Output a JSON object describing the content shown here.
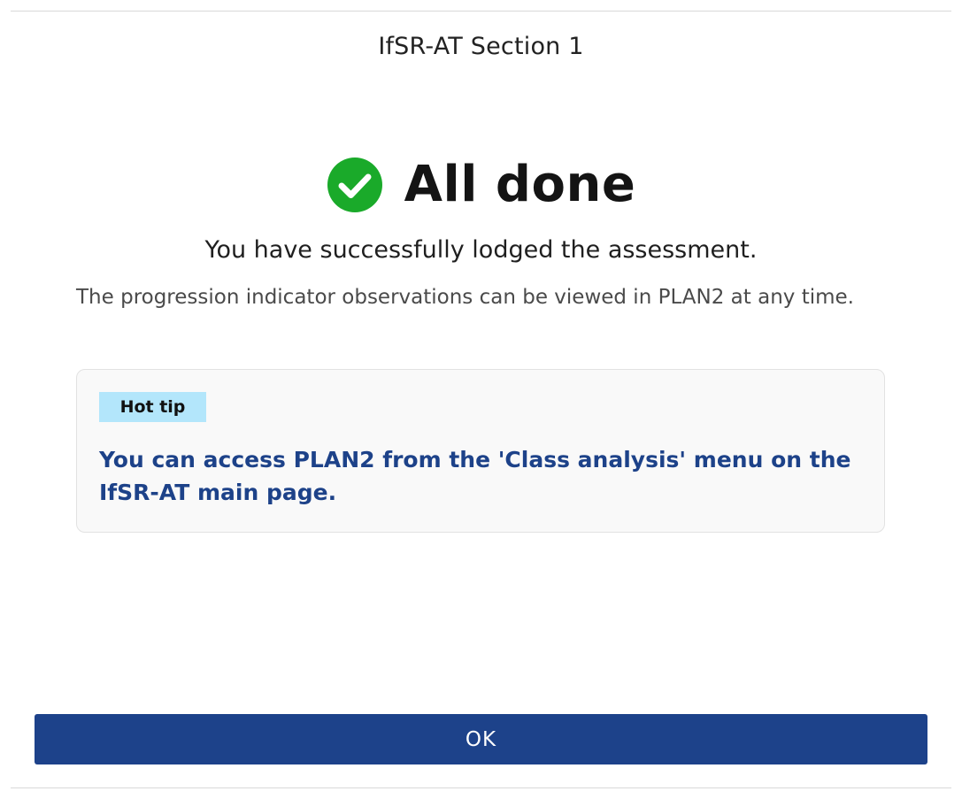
{
  "dialog": {
    "title": "IfSR-AT Section 1",
    "heading": "All done",
    "success_message": "You have successfully lodged the assessment.",
    "info_message": "The progression indicator observations can be viewed in PLAN2 at any time.",
    "tip": {
      "badge": "Hot tip",
      "text": "You can access PLAN2 from the 'Class analysis' menu on the IfSR-AT main page."
    },
    "ok_label": "OK"
  },
  "icons": {
    "status": "check-circle-icon"
  },
  "colors": {
    "success_green": "#1aaa2a",
    "primary_blue": "#1d428a",
    "tip_text_blue": "#1d4289",
    "tip_badge_bg": "#b3e6fb"
  }
}
